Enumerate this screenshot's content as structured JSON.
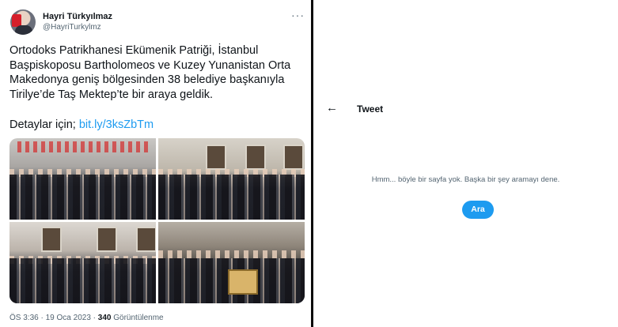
{
  "tweet": {
    "author": {
      "name": "Hayri Türkyılmaz",
      "handle": "@HayriTurkylmz"
    },
    "text_lines": [
      "Ortodoks Patrikhanesi Ekümenik Patriği, İstanbul",
      "Başpiskoposu Bartholomeos ve Kuzey Yunanistan Orta",
      "Makedonya geniş bölgesinden 38 belediye başkanıyla",
      "Tirilye’de Taş Mektep’te bir araya geldik."
    ],
    "details_prefix": "Detaylar için;",
    "link": "bit.ly/3ksZbTm",
    "time": "ÖS 3:36",
    "separator": "·",
    "date": "19 Oca 2023",
    "views_count": "340",
    "views_label": "Görüntülenme",
    "more_icon": "more-horizontal-icon"
  },
  "right_panel": {
    "back_icon": "back-arrow-icon",
    "title": "Tweet",
    "empty_message": "Hmm... böyle bir sayfa yok. Başka bir şey aramayı dene.",
    "search_button": "Ara"
  },
  "colors": {
    "accent": "#1d9bf0",
    "text": "#0f1419",
    "muted": "#536471",
    "divider": "#0a0a0a"
  }
}
